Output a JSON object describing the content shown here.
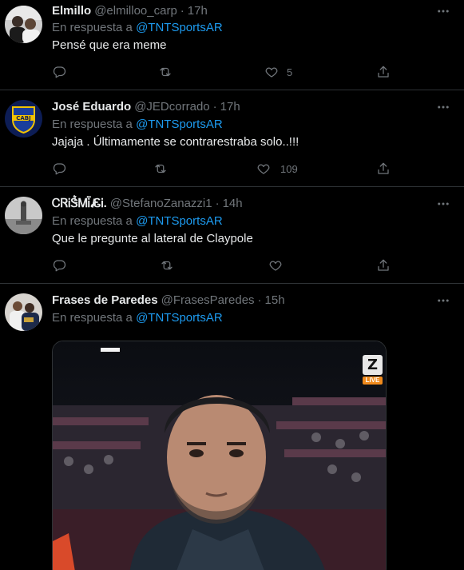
{
  "tweets": [
    {
      "name": "Elmillo",
      "handle": "@elmilloo_carp",
      "time": "17h",
      "reply_prefix": "En respuesta a",
      "reply_to": "@TNTSportsAR",
      "text": "Pensé que era meme",
      "likes": "5",
      "avatar_icon": "profile-photo-two-men"
    },
    {
      "name": "José Eduardo",
      "handle": "@JEDcorrado",
      "time": "17h",
      "reply_prefix": "En respuesta a",
      "reply_to": "@TNTSportsAR",
      "text": "Jajaja . Últimamente se contrarestraba solo..!!!",
      "likes": "109",
      "avatar_icon": "boca-juniors-crest"
    },
    {
      "name": "ᏟᏒᎥᏕ͛ᎷᎥ̈ ̸̴̴̷̷̷̷̷̸̷̸̷ᏋᎥ.",
      "handle": "@StefanoZanazzi1",
      "time": "14h",
      "reply_prefix": "En respuesta a",
      "reply_to": "@TNTSportsAR",
      "text": "Que le pregunte al lateral de Claypole",
      "likes": "",
      "avatar_icon": "statue-photo"
    },
    {
      "name": "Frases de Paredes",
      "handle": "@FrasesParedes",
      "time": "15h",
      "reply_prefix": "En respuesta a",
      "reply_to": "@TNTSportsAR",
      "text": "",
      "likes": "",
      "avatar_icon": "two-players-photo",
      "media": {
        "badge_letter": "Z",
        "badge_live": "LIVE",
        "description_icon": "coach-stadium-photo"
      }
    }
  ],
  "colors": {
    "background": "#000000",
    "text": "#e7e9ea",
    "muted": "#71767b",
    "link": "#1d9bf0",
    "divider": "#2f3336"
  }
}
